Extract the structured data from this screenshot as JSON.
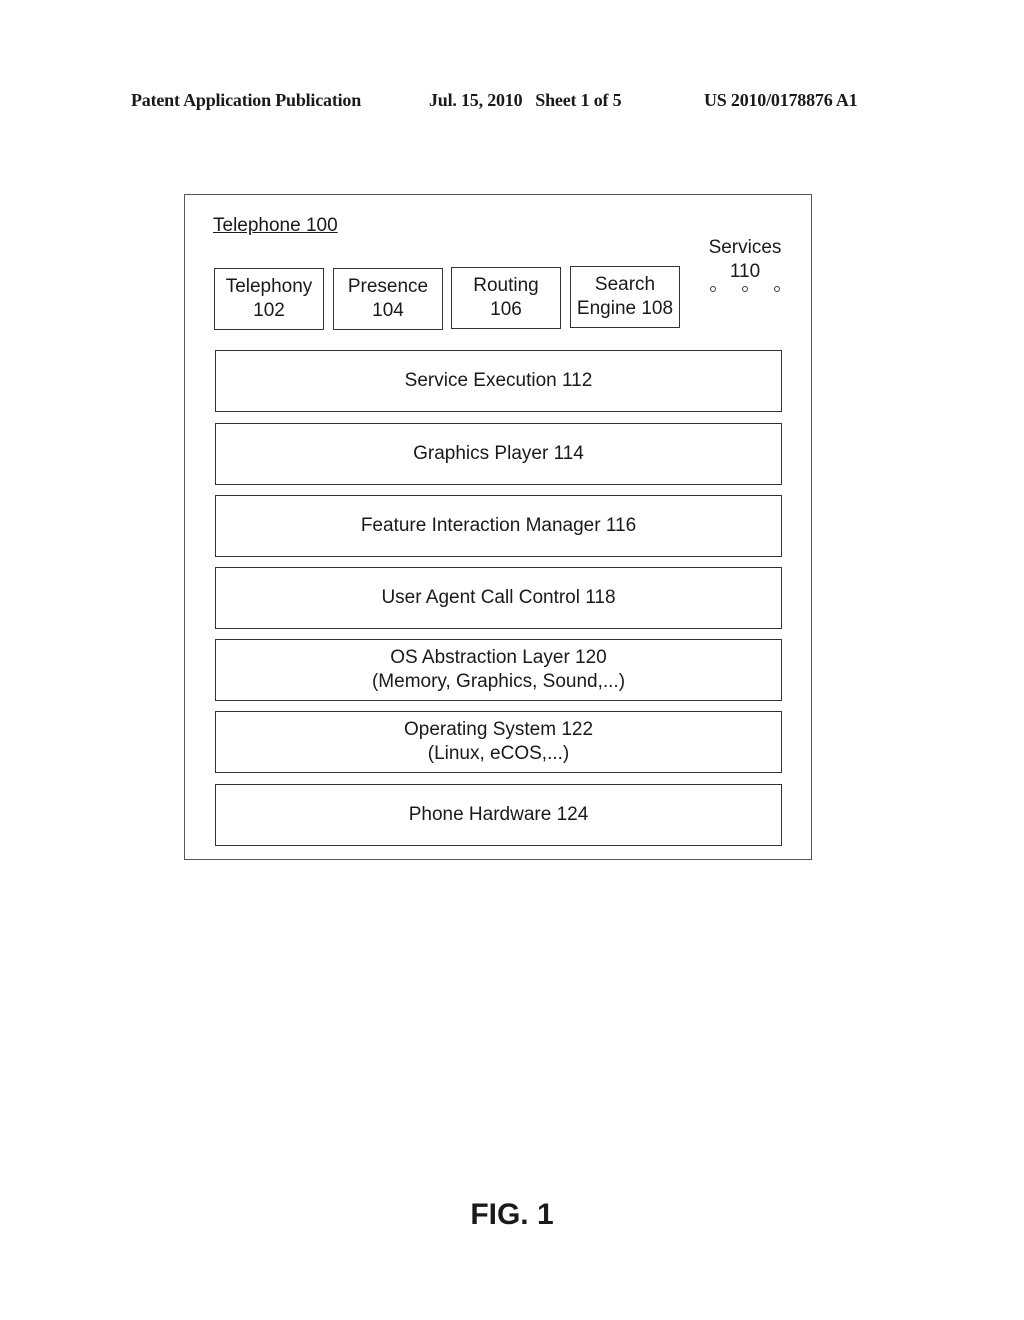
{
  "header": {
    "publication": "Patent Application Publication",
    "date_sheet": "Jul. 15, 2010   Sheet 1 of 5",
    "number": "US 2010/0178876 A1"
  },
  "diagram": {
    "title": "Telephone 100",
    "services": [
      {
        "line1": "Telephony",
        "line2": "102"
      },
      {
        "line1": "Presence",
        "line2": "104"
      },
      {
        "line1": "Routing",
        "line2": "106"
      },
      {
        "line1": "Search",
        "line2": "Engine 108"
      }
    ],
    "services_label": {
      "line1": "Services",
      "line2": "110"
    },
    "layers": [
      {
        "line1": "Service Execution 112",
        "line2": ""
      },
      {
        "line1": "Graphics Player 114",
        "line2": ""
      },
      {
        "line1": "Feature Interaction Manager 116",
        "line2": ""
      },
      {
        "line1": "User Agent Call Control 118",
        "line2": ""
      },
      {
        "line1": "OS Abstraction Layer 120",
        "line2": "(Memory, Graphics, Sound,...)"
      },
      {
        "line1": "Operating System 122",
        "line2": "(Linux, eCOS,...)"
      },
      {
        "line1": "Phone Hardware 124",
        "line2": ""
      }
    ]
  },
  "figure_label": "FIG. 1"
}
